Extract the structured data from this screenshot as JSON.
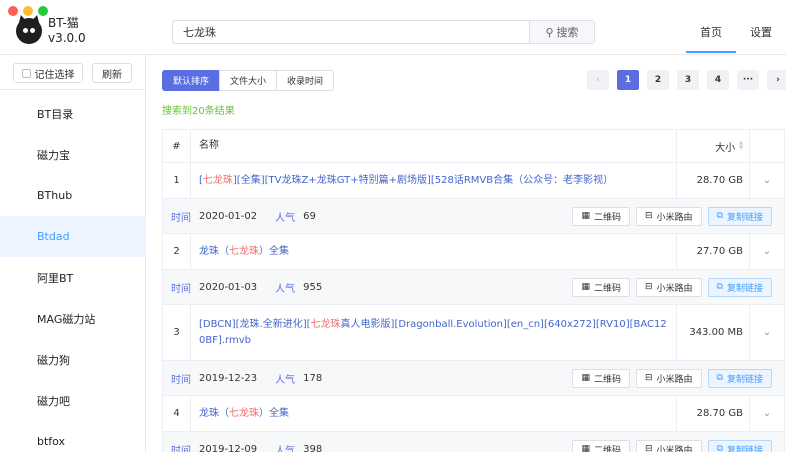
{
  "app": {
    "name": "BT-猫",
    "version": "v3.0.0"
  },
  "search": {
    "value": "七龙珠",
    "button": "搜索"
  },
  "nav": {
    "home": "首页",
    "settings": "设置"
  },
  "sidebar": {
    "remember": "记住选择",
    "refresh": "刷新",
    "items": [
      {
        "label": "BT目录"
      },
      {
        "label": "磁力宝"
      },
      {
        "label": "BThub"
      },
      {
        "label": "Btdad"
      },
      {
        "label": "阿里BT"
      },
      {
        "label": "MAG磁力站"
      },
      {
        "label": "磁力狗"
      },
      {
        "label": "磁力吧"
      },
      {
        "label": "btfox"
      }
    ],
    "active_index": 3
  },
  "sort": {
    "default": "默认排序",
    "size": "文件大小",
    "time": "收录时间"
  },
  "pager": {
    "pages": [
      "1",
      "2",
      "3",
      "4",
      "···"
    ],
    "prev": "‹",
    "next": "›",
    "current": "1"
  },
  "result_count": "搜索到20条结果",
  "table": {
    "headers": {
      "index": "#",
      "name": "名称",
      "size": "大小"
    },
    "meta_labels": {
      "time": "时间",
      "popularity": "人气"
    },
    "buttons": {
      "qrcode": "二维码",
      "router": "小米路由",
      "copy": "复制链接"
    },
    "rows": [
      {
        "index": "1",
        "name_pre": "[",
        "name_hl": "七龙珠",
        "name_post": "][全集][TV龙珠Z+龙珠GT+特别篇+剧场版][528话RMVB合集（公众号：老李影视）",
        "size": "28.70 GB",
        "time": "2020-01-02",
        "popularity": "69"
      },
      {
        "index": "2",
        "name_pre": "龙珠（",
        "name_hl": "七龙珠",
        "name_post": "）全集",
        "size": "27.70 GB",
        "time": "2020-01-03",
        "popularity": "955"
      },
      {
        "index": "3",
        "name_pre": "[DBCN][龙珠.全新进化][",
        "name_hl": "七龙珠",
        "name_post": "真人电影版][Dragonball.Evolution][en_cn][640x272][RV10][BAC120BF].rmvb",
        "size": "343.00 MB",
        "time": "2019-12-23",
        "popularity": "178"
      },
      {
        "index": "4",
        "name_pre": "龙珠（",
        "name_hl": "七龙珠",
        "name_post": "）全集",
        "size": "28.70 GB",
        "time": "2019-12-09",
        "popularity": "398"
      }
    ]
  },
  "colors": {
    "accent": "#5b6ee1",
    "highlight": "#f56c6c",
    "success": "#67c23a",
    "link": "#4466cc"
  }
}
